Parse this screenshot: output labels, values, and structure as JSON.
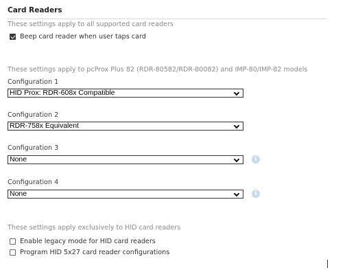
{
  "section": {
    "title": "Card Readers",
    "all_readers_note": "These settings apply to all supported card readers",
    "beep_checkbox": {
      "label": "Beep card reader when user taps card",
      "checked": true
    },
    "pcprox_note": "These settings apply to pcProx Plus 82 (RDR-80582/RDR-80082) and IMP-80/IMP-82 models",
    "configurations": [
      {
        "label": "Configuration 1",
        "value": "HID Prox: RDR-608x Compatible",
        "info_icon": false
      },
      {
        "label": "Configuration 2",
        "value": "RDR-758x Equivalent",
        "info_icon": false
      },
      {
        "label": "Configuration 3",
        "value": "None",
        "info_icon": true
      },
      {
        "label": "Configuration 4",
        "value": "None",
        "info_icon": true
      }
    ],
    "hid_note": "These settings apply exclusively to HID card readers",
    "legacy_checkbox": {
      "label": "Enable legacy mode for HID card readers",
      "checked": false
    },
    "program_checkbox": {
      "label": "Program HID 5x27 card reader configurations",
      "checked": false
    }
  },
  "icons": {
    "info": "info-icon",
    "dropdown": "chevron-down-icon",
    "check": "checkmark-icon"
  },
  "colors": {
    "info_icon": "#c9dced",
    "text_muted": "#8a8a8a",
    "rule": "#dcdcdc"
  }
}
